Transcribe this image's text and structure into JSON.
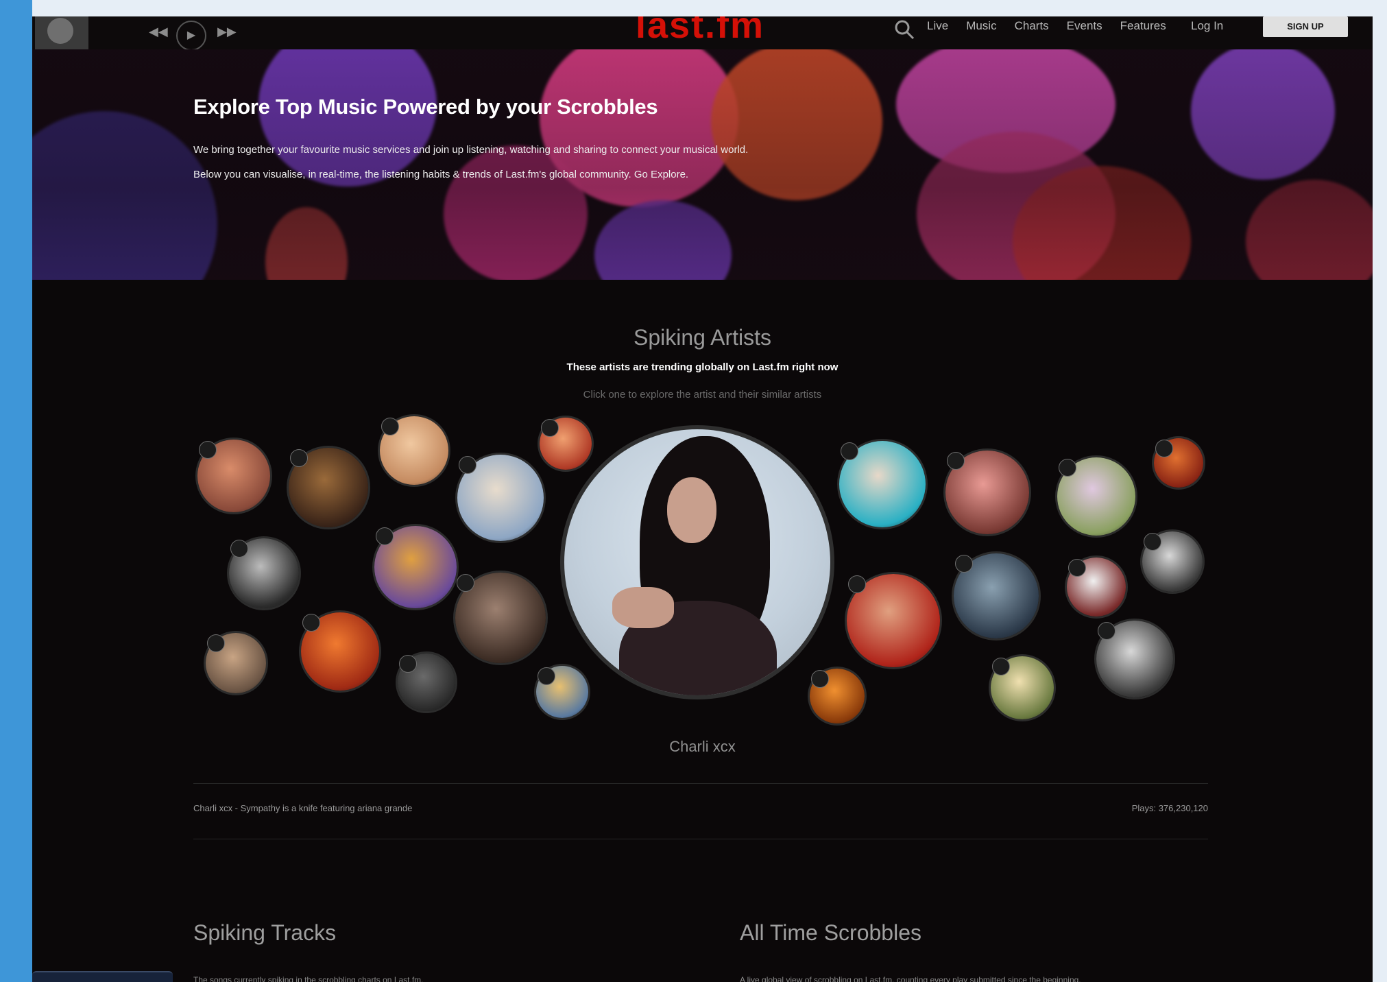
{
  "nav": {
    "logo": "last.fm",
    "links": [
      "Live",
      "Music",
      "Charts",
      "Events",
      "Features"
    ],
    "login": "Log In",
    "signup": "SIGN UP",
    "icons": {
      "search": "search-icon",
      "prev": "skip-back-icon",
      "play": "play-icon",
      "next": "skip-forward-icon",
      "avatar": "user-avatar"
    }
  },
  "hero": {
    "title": "Explore Top Music Powered by your Scrobbles",
    "line1": "We bring together your favourite music services and join up listening, watching and sharing to connect your musical world.",
    "line2": "Below you can visualise, in real-time, the listening habits & trends of Last.fm's global community. Go Explore."
  },
  "spiking_artists": {
    "title": "Spiking Artists",
    "description": "These artists are trending globally on Last.fm right now",
    "hint": "Click one to explore the artist and their similar artists",
    "featured_artist": "Charli xcx",
    "now_playing": "Charli xcx - Sympathy is a knife featuring ariana grande",
    "plays": "Plays: 376,230,120"
  },
  "spiking_tracks": {
    "title": "Spiking Tracks",
    "description": "The songs currently spiking in the scrobbling charts on Last.fm."
  },
  "all_time": {
    "title": "All Time Scrobbles",
    "description": "A live global view of scrobbling on Last.fm, counting every play submitted since the beginning."
  },
  "colors": {
    "accent": "#d51007",
    "background": "#0b0809",
    "side_bar": "#3e96d8"
  }
}
